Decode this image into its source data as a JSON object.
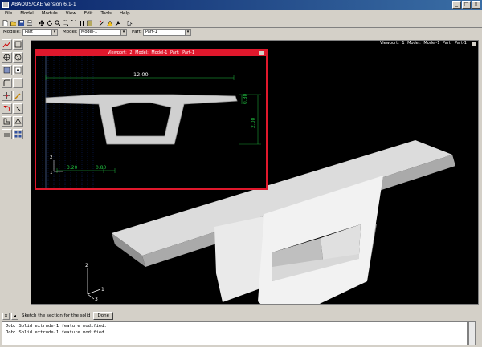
{
  "window": {
    "title": "ABAQUS/CAE Version 6.1-1",
    "min_glyph": "_",
    "max_glyph": "□",
    "close_glyph": "×"
  },
  "menu": [
    "File",
    "Model",
    "Module",
    "View",
    "Edit",
    "Tools",
    "Help"
  ],
  "toolbar": {
    "icons": [
      "new-file-icon",
      "open-file-icon",
      "save-icon",
      "print-icon",
      "pan-icon",
      "rotate-icon",
      "zoom-icon",
      "zoom-box-icon",
      "fit-view-icon",
      "cycle-view-icon",
      "render-icon",
      "query-icon",
      "display-options-icon",
      "tools-icon",
      "whats-this-icon"
    ]
  },
  "context": {
    "module_label": "Module:",
    "module_value": "Part",
    "model_label": "Model:",
    "model_value": "Model-1",
    "part_label": "Part:",
    "part_value": "Part-1"
  },
  "viewport_main": {
    "title": "Viewport: 1    Model: Model-1    Part: Part-1",
    "triad": {
      "axis_y": "2",
      "axis_x": "1",
      "axis_z": "3"
    }
  },
  "viewport_inset": {
    "title": "Viewport: 2    Model: Model-1    Part: Part-1",
    "dims": {
      "top_width": "12.00",
      "right_small": "0.30",
      "right_height": "2.00",
      "bottom_left": "3.20",
      "bottom_mid": "0.80"
    },
    "axis": {
      "y": "2",
      "x": "1"
    }
  },
  "prompt": {
    "text": "Sketch the section for the solid",
    "done_label": "Done"
  },
  "messages": [
    "Job: Solid extrude-1 feature modified.",
    "Job: Solid extrude-1 feature modified."
  ]
}
